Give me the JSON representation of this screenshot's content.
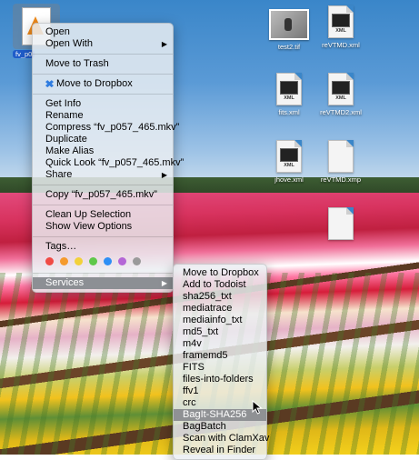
{
  "desktop": {
    "selected_file": {
      "label": "fv_p0",
      "icon": "vlc-cone-icon"
    },
    "icons": [
      {
        "name": "test2.tif",
        "kind": "image-thumbnail"
      },
      {
        "name": "reVTMD.xml",
        "kind": "xml",
        "tag": "XML"
      },
      {
        "name": "fits.xml",
        "kind": "xml",
        "tag": "XML"
      },
      {
        "name": "reVTMD2.xml",
        "kind": "xml",
        "tag": "XML"
      },
      {
        "name": "jhove.xml",
        "kind": "xml",
        "tag": "XML"
      },
      {
        "name": "reVTMD.xmp",
        "kind": "blank"
      },
      {
        "name": "",
        "kind": "blank"
      }
    ]
  },
  "context_menu": {
    "open": "Open",
    "open_with": "Open With",
    "move_to_trash": "Move to Trash",
    "move_to_dropbox": "Move to Dropbox",
    "get_info": "Get Info",
    "rename": "Rename",
    "compress": "Compress “fv_p057_465.mkv”",
    "duplicate": "Duplicate",
    "make_alias": "Make Alias",
    "quick_look": "Quick Look “fv_p057_465.mkv”",
    "share": "Share",
    "copy": "Copy “fv_p057_465.mkv”",
    "clean_up_selection": "Clean Up Selection",
    "show_view_options": "Show View Options",
    "tags": "Tags…",
    "tag_colors": [
      "#f04b45",
      "#f59a2d",
      "#f2d13a",
      "#5fc84a",
      "#2e8ff5",
      "#b466d6",
      "#9a9a9a"
    ],
    "services": "Services"
  },
  "services_menu": {
    "items": [
      "Move to Dropbox",
      "Add to Todoist",
      "sha256_txt",
      "mediatrace",
      "mediainfo_txt",
      "md5_txt",
      "m4v",
      "framemd5",
      "FITS",
      "files-into-folders",
      "ffv1",
      "crc",
      "BagIt-SHA256",
      "BagBatch",
      "Scan with ClamXav",
      "Reveal in Finder"
    ],
    "highlighted": "BagIt-SHA256"
  }
}
